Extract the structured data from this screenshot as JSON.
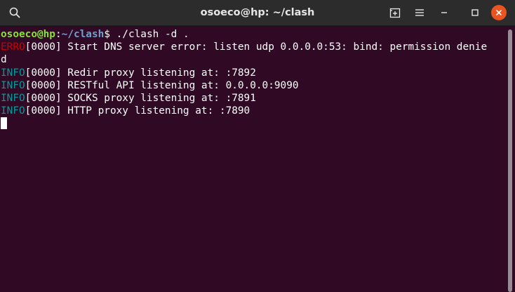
{
  "window": {
    "title": "osoeco@hp: ~/clash"
  },
  "colors": {
    "terminal_bg": "#300a24",
    "titlebar_bg": "#2c2c2c",
    "prompt_user": "#8ae234",
    "prompt_path": "#729fcf",
    "error_level": "#cc0000",
    "info_level": "#06989a",
    "close_button": "#e95420"
  },
  "icons": {
    "search": "search-icon",
    "new_tab": "new-tab-icon",
    "menu": "hamburger-menu-icon",
    "minimize": "minimize-icon",
    "maximize": "maximize-icon",
    "close": "close-icon"
  },
  "terminal": {
    "prompt": {
      "user_host": "osoeco@hp",
      "separator": ":",
      "path": "~/clash",
      "symbol": "$",
      "command": " ./clash -d ."
    },
    "lines": [
      {
        "level": "ERRO",
        "text": "[0000] Start DNS server error: listen udp 0.0.0.0:53: bind: permission denie"
      },
      {
        "level": "",
        "text": "d"
      },
      {
        "level": "INFO",
        "text": "[0000] Redir proxy listening at: :7892"
      },
      {
        "level": "INFO",
        "text": "[0000] RESTful API listening at: 0.0.0.0:9090"
      },
      {
        "level": "INFO",
        "text": "[0000] SOCKS proxy listening at: :7891"
      },
      {
        "level": "INFO",
        "text": "[0000] HTTP proxy listening at: :7890"
      }
    ]
  }
}
